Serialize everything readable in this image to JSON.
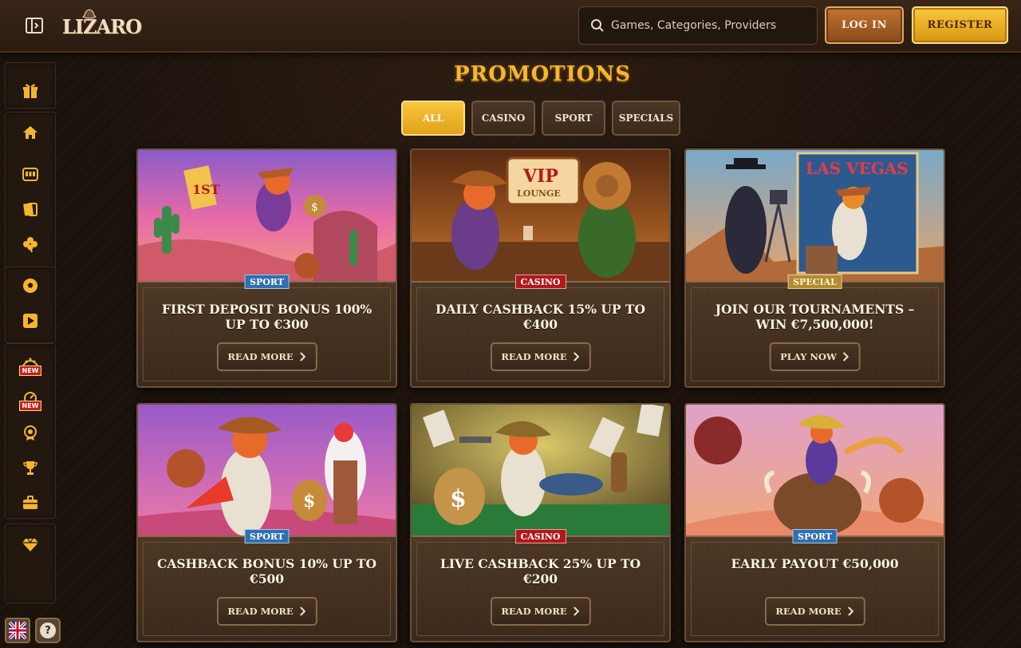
{
  "header": {
    "logo_text": "LIZARO",
    "search_placeholder": "Games, Categories, Providers",
    "login_label": "LOG IN",
    "register_label": "REGISTER"
  },
  "sidebar": {
    "items": [
      {
        "icon": "gift-icon"
      },
      {
        "icon": "home-icon"
      },
      {
        "icon": "slot-machine-icon"
      },
      {
        "icon": "cards-icon"
      },
      {
        "icon": "clover-icon"
      },
      {
        "icon": "soccer-ball-icon"
      },
      {
        "icon": "play-icon"
      },
      {
        "icon": "new-game-icon",
        "badge": "NEW"
      },
      {
        "icon": "new-game-icon",
        "badge": "NEW"
      },
      {
        "icon": "badge-icon"
      },
      {
        "icon": "trophy-icon"
      },
      {
        "icon": "briefcase-icon"
      },
      {
        "icon": "diamond-icon"
      }
    ],
    "language_icon": "uk-flag-icon",
    "help_label": "?"
  },
  "page": {
    "title": "PROMOTIONS"
  },
  "tabs": [
    {
      "label": "ALL",
      "active": true
    },
    {
      "label": "CASINO",
      "active": false
    },
    {
      "label": "SPORT",
      "active": false
    },
    {
      "label": "SPECIALS",
      "active": false
    }
  ],
  "promotions": [
    {
      "tag": "SPORT",
      "title": "FIRST DEPOSIT BONUS 100% UP TO €300",
      "button": "READ MORE"
    },
    {
      "tag": "CASINO",
      "title": "DAILY CASHBACK 15% UP TO €400",
      "button": "READ MORE",
      "image_text": [
        "VIP",
        "LOUNGE"
      ]
    },
    {
      "tag": "SPECIAL",
      "title": "JOIN OUR TOURNAMENTS – WIN €7,500,000!",
      "button": "PLAY NOW",
      "image_text": [
        "LAS VEGAS"
      ]
    },
    {
      "tag": "SPORT",
      "title": "CASHBACK BONUS 10% UP TO €500",
      "button": "READ MORE"
    },
    {
      "tag": "CASINO",
      "title": "LIVE CASHBACK 25% UP TO €200",
      "button": "READ MORE"
    },
    {
      "tag": "SPORT",
      "title": "EARLY PAYOUT €50,000",
      "button": "READ MORE"
    }
  ],
  "colors": {
    "accent_gold": "#f7b62c",
    "sport_tag": "#2f6fb3",
    "casino_tag": "#b3191b",
    "special_tag": "#b38a2f"
  }
}
